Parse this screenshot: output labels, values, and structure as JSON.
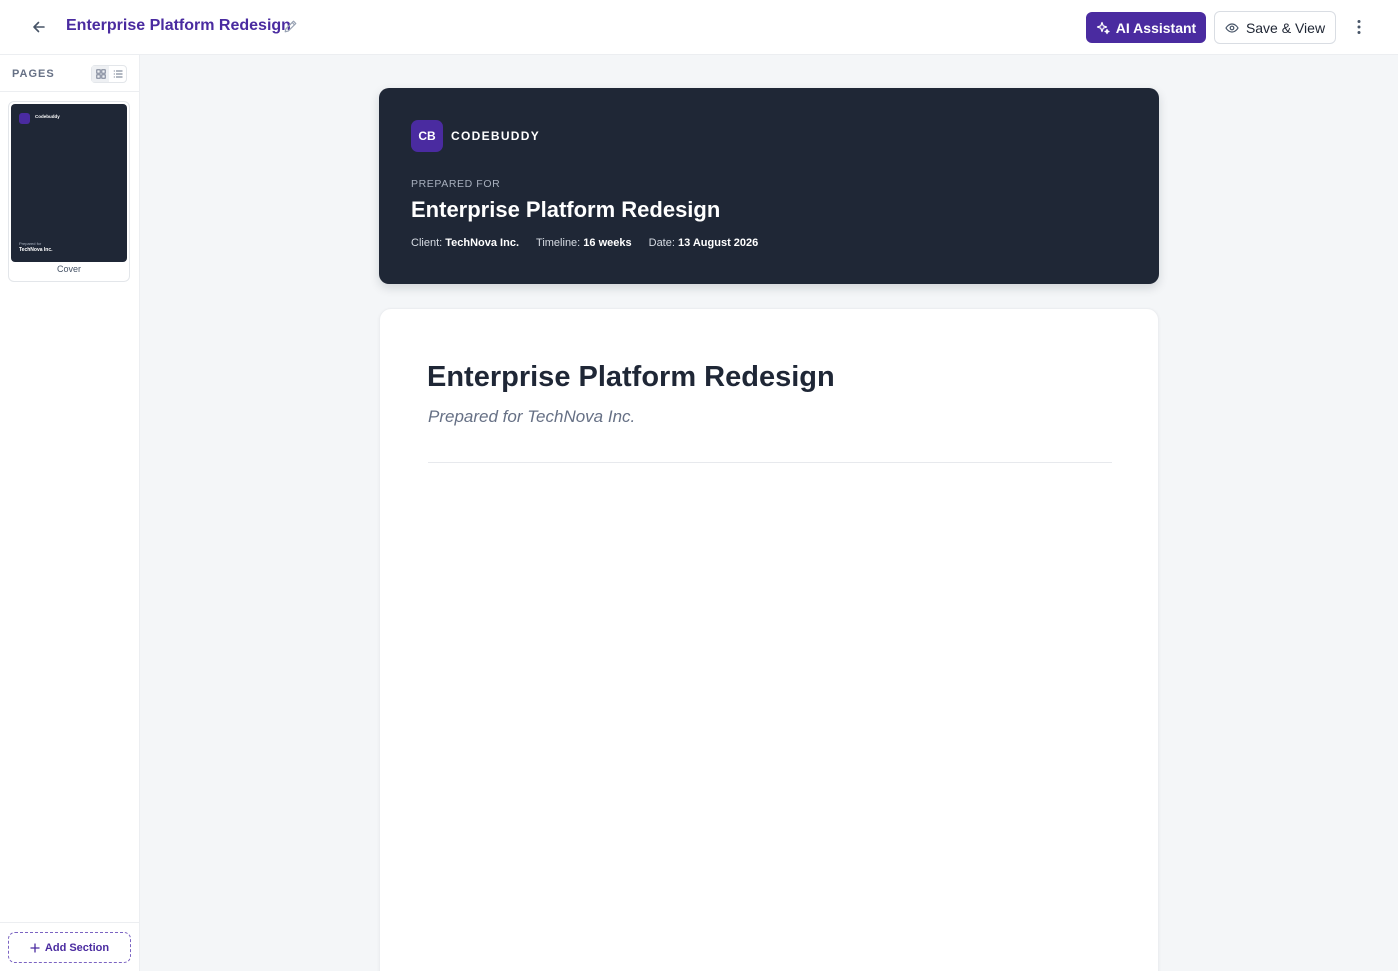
{
  "header": {
    "title": "Enterprise Platform Redesign",
    "ai_label": "AI Assistant",
    "save_label": "Save & View",
    "icons": [
      "arrow-left-icon",
      "pencil-icon",
      "sparkles-icon",
      "eye-icon",
      "more-vertical-icon"
    ]
  },
  "sidebar": {
    "label": "PAGES",
    "view_modes": [
      "grid",
      "list"
    ],
    "pages": [
      {
        "caption": "Cover",
        "thumb_brand": "Codebuddy",
        "thumb_prepared": "Prepared for",
        "thumb_client": "TechNova Inc."
      }
    ],
    "add_label": "Add Section"
  },
  "cover": {
    "logo": "CB",
    "brand": "CODEBUDDY",
    "prepared_label": "PREPARED FOR",
    "title": "Enterprise Platform Redesign",
    "meta": {
      "client_label": "Client:",
      "client": "TechNova Inc.",
      "timeline_label": "Timeline:",
      "timeline": "16 weeks",
      "date_label": "Date:",
      "date": "13 August 2026"
    }
  },
  "document": {
    "heading": "Enterprise Platform Redesign",
    "subtitle": "Prepared for TechNova Inc."
  },
  "colors": {
    "accent": "#4a2ba0",
    "cover_bg": "#1f2736",
    "canvas_bg": "#f4f6f8"
  }
}
